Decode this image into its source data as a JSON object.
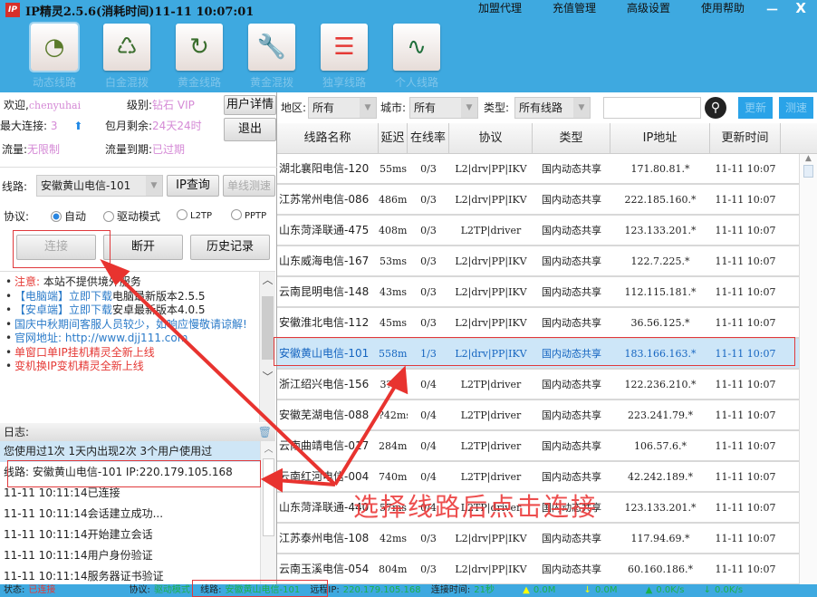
{
  "app": {
    "title": "IP精灵2.5.6(消耗时间)11-11 10:07:01",
    "logo": "IP",
    "menu": [
      "加盟代理",
      "充值管理",
      "高级设置",
      "使用帮助"
    ],
    "minimize": "－",
    "close": "X"
  },
  "toolbar": [
    {
      "label": "动态线路",
      "icon": "globe-clock-icon",
      "glyph": "◔"
    },
    {
      "label": "白金混拨",
      "icon": "users-refresh-icon",
      "glyph": "♺"
    },
    {
      "label": "黄金线路",
      "icon": "user-refresh-icon",
      "glyph": "↻"
    },
    {
      "label": "黄金混拨",
      "icon": "wrench-users-icon",
      "glyph": "🔧"
    },
    {
      "label": "独享线路",
      "icon": "user-card-icon",
      "glyph": "☰"
    },
    {
      "label": "个人线路",
      "icon": "pulse-icon",
      "glyph": "∿"
    }
  ],
  "user": {
    "welcome_label": "欢迎,",
    "username": "chenyuhai",
    "level_label": "级别:",
    "level": "钻石 VIP",
    "maxconn_label": "最大连接:",
    "maxconn": "3",
    "monthly_label": "包月剩余:",
    "monthly": "24天24时",
    "traffic_label": "流量:",
    "traffic": "无限制",
    "traffic_exp_label": "流量到期:",
    "traffic_exp": "已过期",
    "details_btn": "用户详情",
    "logout_btn": "退出"
  },
  "line": {
    "label": "线路:",
    "value": "安徽黄山电信-101",
    "ip_query": "IP查询",
    "speed_test": "单线测速"
  },
  "protocol": {
    "label": "协议:",
    "options": [
      "自动",
      "驱动模式",
      "L2TP",
      "PPTP"
    ],
    "selected": "自动"
  },
  "actions": {
    "connect": "连接",
    "disconnect": "断开",
    "history": "历史记录"
  },
  "notices": [
    {
      "parts": [
        {
          "t": "注意:",
          "c": "#e53935"
        },
        {
          "t": "  本站不提供境外服务",
          "c": "#222"
        }
      ]
    },
    {
      "parts": [
        {
          "t": "【电脑端】立即下载",
          "c": "#2b7bc9"
        },
        {
          "t": "电脑最新版本2.5.5",
          "c": "#222"
        }
      ]
    },
    {
      "parts": [
        {
          "t": "【安卓端】立即下载",
          "c": "#2b7bc9"
        },
        {
          "t": "安卓最新版本4.0.5",
          "c": "#222"
        }
      ]
    },
    {
      "parts": [
        {
          "t": "国庆中秋期间客服人员较少，如响应慢敬请谅解!",
          "c": "#2b7bc9"
        }
      ]
    },
    {
      "parts": [
        {
          "t": "官网地址: http://www.djj111.com",
          "c": "#2b7bc9"
        }
      ]
    },
    {
      "parts": [
        {
          "t": "单窗口单IP挂机精灵全新上线",
          "c": "#e53935"
        }
      ]
    },
    {
      "parts": [
        {
          "t": "变机换IP变机精灵全新上线",
          "c": "#e53935"
        }
      ]
    }
  ],
  "log": {
    "title": "日志:",
    "entries": [
      "您使用过1次 1天内出现2次 3个用户使用过",
      "线路: 安徽黄山电信-101 IP:220.179.105.168",
      "11-11 10:11:14已连接",
      "11-11 10:11:14会话建立成功...",
      "11-11 10:11:14开始建立会话",
      "11-11 10:11:14用户身份验证",
      "11-11 10:11:14服务器证书验证"
    ]
  },
  "filters": {
    "region_label": "地区:",
    "region": "所有",
    "city_label": "城市:",
    "city": "所有",
    "type_label": "类型:",
    "type": "所有线路",
    "search_value": "",
    "refresh": "更新",
    "speedtest": "测速"
  },
  "table": {
    "columns": [
      "线路名称",
      "延迟",
      "在线率",
      "协议",
      "类型",
      "IP地址",
      "更新时间"
    ],
    "rows": [
      [
        "湖北襄阳电信-120",
        "55ms",
        "0/3",
        "L2|drv|PP|IKV",
        "国内动态共享",
        "171.80.81.*",
        "11-11 10:07"
      ],
      [
        "江苏常州电信-086",
        "486ms",
        "0/3",
        "L2|drv|PP|IKV",
        "国内动态共享",
        "222.185.160.*",
        "11-11 10:07"
      ],
      [
        "山东菏泽联通-475",
        "408ms",
        "0/3",
        "L2TP|driver",
        "国内动态共享",
        "123.133.201.*",
        "11-11 10:07"
      ],
      [
        "山东威海电信-167",
        "53ms",
        "0/3",
        "L2|drv|PP|IKV",
        "国内动态共享",
        "122.7.225.*",
        "11-11 10:07"
      ],
      [
        "云南昆明电信-148",
        "43ms",
        "0/3",
        "L2|drv|PP|IKV",
        "国内动态共享",
        "112.115.181.*",
        "11-11 10:07"
      ],
      [
        "安徽淮北电信-112",
        "45ms",
        "0/3",
        "L2|drv|PP|IKV",
        "国内动态共享",
        "36.56.125.*",
        "11-11 10:07"
      ],
      [
        "安徽黄山电信-101",
        "558ms",
        "1/3",
        "L2|drv|PP|IKV",
        "国内动态共享",
        "183.166.163.*",
        "11-11 10:07"
      ],
      [
        "浙江绍兴电信-156",
        "3?ms",
        "0/4",
        "L2TP|driver",
        "国内动态共享",
        "122.236.210.*",
        "11-11 10:07"
      ],
      [
        "安徽芜湖电信-088",
        "?42ms",
        "0/4",
        "L2TP|driver",
        "国内动态共享",
        "223.241.79.*",
        "11-11 10:07"
      ],
      [
        "云南曲靖电信-017",
        "284ms",
        "0/4",
        "L2TP|driver",
        "国内动态共享",
        "106.57.6.*",
        "11-11 10:07"
      ],
      [
        "云南红河电信-004",
        "740ms",
        "0/4",
        "L2TP|driver",
        "国内动态共享",
        "42.242.189.*",
        "11-11 10:07"
      ],
      [
        "山东菏泽联通-440",
        "57ms",
        "0/4",
        "L2TP|driver",
        "国内动态共享",
        "123.133.201.*",
        "11-11 10:07"
      ],
      [
        "江苏泰州电信-108",
        "42ms",
        "0/3",
        "L2|drv|PP|IKV",
        "国内动态共享",
        "117.94.69.*",
        "11-11 10:07"
      ],
      [
        "云南玉溪电信-054",
        "804ms",
        "0/3",
        "L2|drv|PP|IKV",
        "国内动态共享",
        "60.160.186.*",
        "11-11 10:07"
      ]
    ],
    "selected_index": 6
  },
  "status": {
    "state_label": "状态:",
    "state": "已连接",
    "protocol_label": "协议:",
    "protocol": "驱动模式",
    "line_label": "线路:",
    "line": "安徽黄山电信-101",
    "remote_label": "远程IP:",
    "remote": "220.179.105.168",
    "time_label": "连接时间:",
    "time": "21秒",
    "down": "0.0M",
    "up": "0.0M",
    "down_rate": "0.0K/s",
    "up_rate": "0.0K/s"
  },
  "annotation": "选择线路后点击连接",
  "colors": {
    "accent": "#3ea9e0",
    "annotation": "#ec3b3b",
    "selected_row": "#cde6f8"
  }
}
